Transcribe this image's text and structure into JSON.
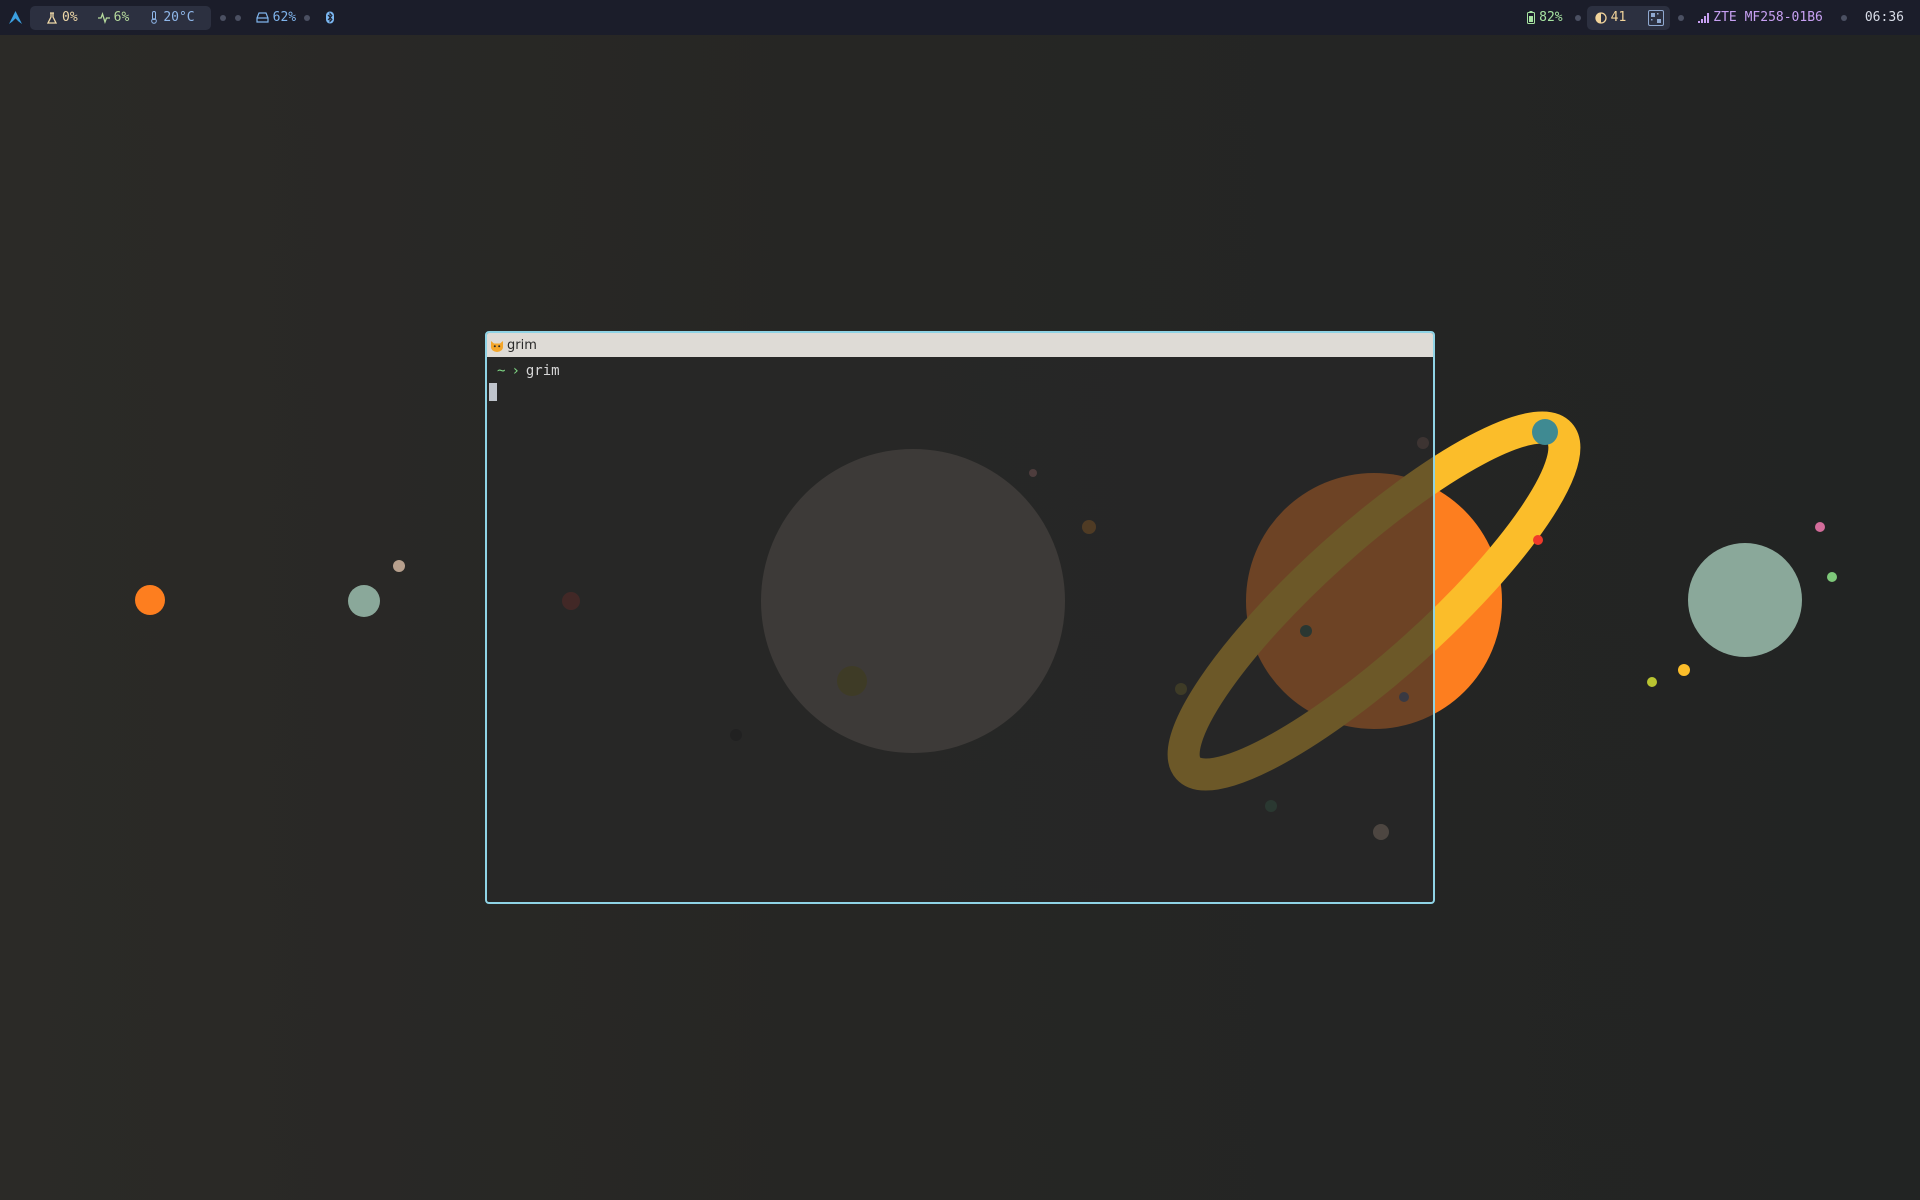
{
  "topbar": {
    "left": {
      "launcher_icon": "arch-logo-icon",
      "cpu": {
        "icon": "flask-icon",
        "value": "0%"
      },
      "memory": {
        "icon": "pulse-icon",
        "value": "6%"
      },
      "temperature": {
        "icon": "thermometer-icon",
        "value": "20°C"
      },
      "disk": {
        "icon": "drive-icon",
        "value": "62%"
      },
      "bluetooth": {
        "icon": "bluetooth-icon"
      }
    },
    "right": {
      "battery": {
        "icon": "battery-icon",
        "value": "82%"
      },
      "brightness": {
        "icon": "brightness-icon",
        "value": "41"
      },
      "tray": {
        "icon": "qr-grid-icon"
      },
      "network": {
        "icon": "signal-icon",
        "value": "ZTE MF258-01B6"
      },
      "clock": "06:36"
    }
  },
  "window": {
    "title": "grim",
    "app_icon": "cat-icon",
    "terminal": {
      "prompt_path": "~",
      "prompt_symbol": "›",
      "command": "grim"
    }
  },
  "colors": {
    "bar_bg": "#1b1d2a",
    "window_border": "#8fd3e5",
    "titlebar_bg": "#dedbd6",
    "planet_orange": "#fd7e1f",
    "ring_yellow": "#fbbd2a",
    "planet_teal": "#8aa89a"
  }
}
